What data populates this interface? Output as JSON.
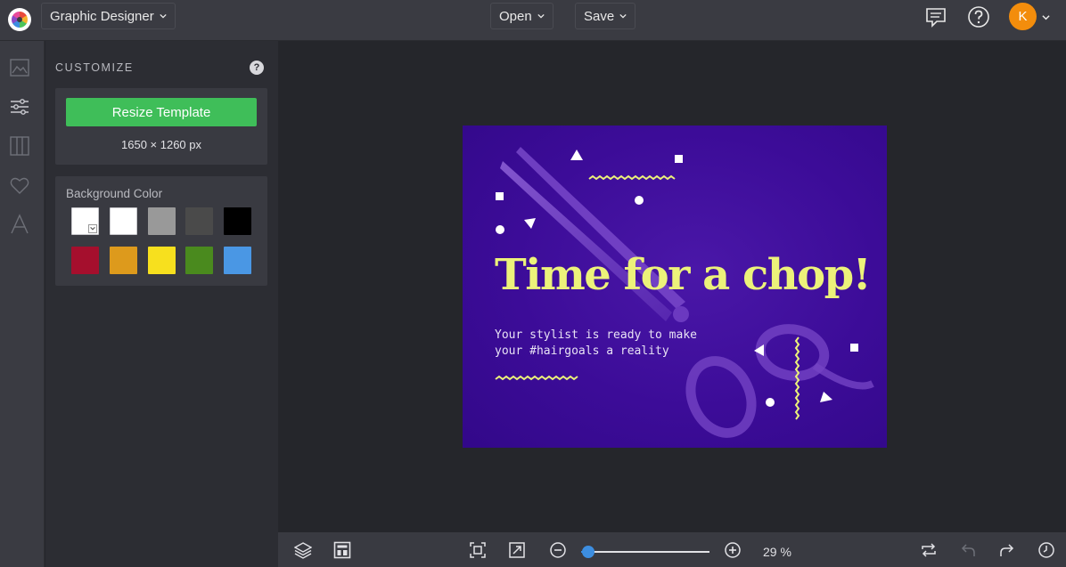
{
  "header": {
    "app_menu_label": "Graphic Designer",
    "open_label": "Open",
    "save_label": "Save",
    "avatar_initial": "K",
    "icons": [
      "comment-icon",
      "help-icon"
    ]
  },
  "rail": {
    "items": [
      "image-icon",
      "sliders-icon",
      "columns-icon",
      "heart-icon",
      "text-icon"
    ]
  },
  "panel": {
    "title": "CUSTOMIZE",
    "help_glyph": "?",
    "resize_button_label": "Resize Template",
    "dimensions": "1650 × 1260 px",
    "background_label": "Background Color",
    "swatches": [
      {
        "color": "#ffffff",
        "role": "custom-picker"
      },
      {
        "color": "#ffffff"
      },
      {
        "color": "#999999"
      },
      {
        "color": "#4a4a4a"
      },
      {
        "color": "#000000"
      },
      {
        "color": "#a50f2d"
      },
      {
        "color": "#dd9a1c"
      },
      {
        "color": "#f7e01e"
      },
      {
        "color": "#4a8a1e"
      },
      {
        "color": "#4a97e4"
      }
    ]
  },
  "design": {
    "headline": "Time for a chop!",
    "subline_1": "Your stylist is ready to make",
    "subline_2": "your #hairgoals a reality",
    "background_color": "#3c0c98",
    "accent_color": "#ecf27a"
  },
  "bottombar": {
    "zoom_label": "29 %",
    "zoom_value": 0.29
  },
  "colors": {
    "accent": "#3fbe59",
    "link_blue": "#3d8ee0",
    "avatar": "#f38d0c"
  }
}
